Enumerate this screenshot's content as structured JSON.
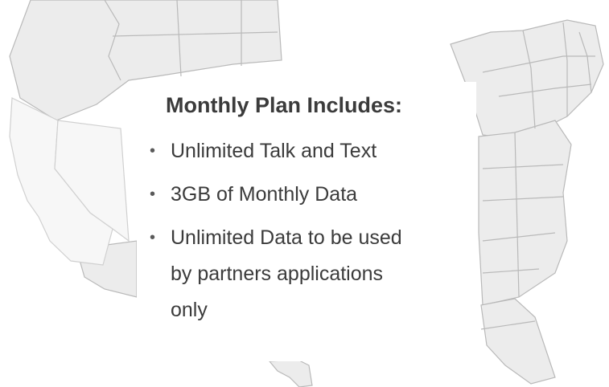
{
  "plan": {
    "title": "Monthly Plan Includes:",
    "bullet_glyph": "•",
    "features": [
      "Unlimited Talk and Text",
      "3GB of Monthly Data",
      "Unlimited Data to be used by partners applications only"
    ]
  },
  "colors": {
    "text": "#3b3b3b",
    "map_fill": "#ececec",
    "map_border": "#b9b9b9",
    "map_highlight": "#f7f7f7"
  },
  "icons": [
    "us-map-illustration",
    "bullet-icon"
  ]
}
